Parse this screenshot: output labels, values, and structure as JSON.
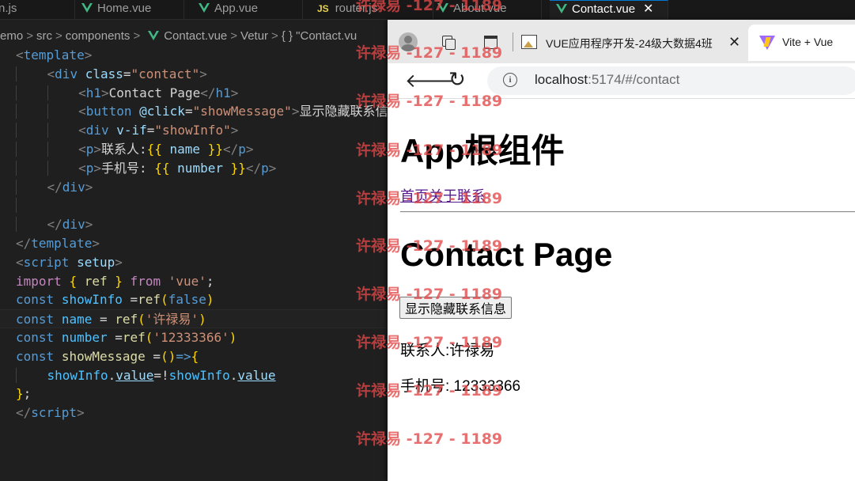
{
  "editor": {
    "tabs": [
      {
        "label": "n.js",
        "icon": "js"
      },
      {
        "label": "Home.vue",
        "icon": "vue"
      },
      {
        "label": "App.vue",
        "icon": "vue"
      },
      {
        "label": "router.js",
        "icon": "js"
      },
      {
        "label": "About.vue",
        "icon": "vue"
      },
      {
        "label": "Contact.vue",
        "icon": "vue",
        "active": true
      }
    ],
    "breadcrumb": {
      "part1": "emo",
      "part2": "src",
      "part3": "components",
      "file": "Contact.vue",
      "part5": "Vetur",
      "part6": "{ } \"Contact.vu"
    },
    "code": {
      "l1": "template",
      "l2_tag": "div",
      "l2_attr": "class",
      "l2_val": "\"contact\"",
      "l3_tag": "h1",
      "l3_text": "Contact Page",
      "l4_tag": "button",
      "l4_attr": "@click",
      "l4_val": "\"showMessage\"",
      "l4_text": "显示隐藏联系信",
      "l5_tag": "div",
      "l5_attr": "v-if",
      "l5_val": "\"showInfo\"",
      "l6_tag": "p",
      "l6_text": "联系人:",
      "l6_var": "name",
      "l7_tag": "p",
      "l7_text": "手机号: ",
      "l7_var": "number",
      "l8_tag": "div",
      "l10_tag": "div",
      "l11_tag": "template",
      "l12_tag": "script",
      "l12_attr": "setup",
      "l13_import": "import",
      "l13_ref": "ref",
      "l13_from": "from",
      "l13_mod": "'vue'",
      "l14_const": "const",
      "l14_var": "showInfo",
      "l14_fn": "ref",
      "l14_arg": "false",
      "l15_const": "const",
      "l15_var": "name",
      "l15_fn": "ref",
      "l15_arg": "'许禄易'",
      "l16_const": "const",
      "l16_var": "number",
      "l16_fn": "ref",
      "l16_arg": "'12333366'",
      "l17_const": "const",
      "l17_var": "showMessage",
      "l18_obj1": "showInfo",
      "l18_prop1": "value",
      "l18_obj2": "showInfo",
      "l18_prop2": "value",
      "l20_tag": "script"
    }
  },
  "browser": {
    "tabs": [
      {
        "title": "VUE应用程序开发-24级大数据4班"
      },
      {
        "title": "Vite + Vue"
      }
    ],
    "url_host": "localhost",
    "url_rest": ":5174/#/contact",
    "page": {
      "app_title": "App根组件",
      "nav_links": [
        "首页",
        "关于",
        "联系"
      ],
      "page_title": "Contact Page",
      "toggle_button": "显示隐藏联系信息",
      "contact_label": "联系人:许禄易",
      "phone_label": "手机号: 12333366"
    }
  },
  "watermark": "许禄易 -127 - 1189",
  "colors": {
    "editor_bg": "#1f1f1f",
    "vue_green": "#41b883",
    "link_purple": "#551a8b",
    "watermark_red": "#e24848"
  }
}
